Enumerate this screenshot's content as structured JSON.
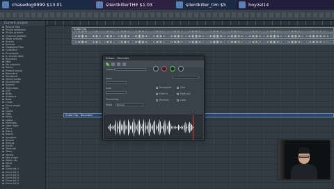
{
  "donations": [
    {
      "name": "chasedog9999",
      "amount": "$13.01"
    },
    {
      "name": "silentkillerTHE",
      "amount": "$1.03"
    },
    {
      "name": "silentkiller_tim",
      "amount": "$5"
    },
    {
      "name": "hoyzel14",
      "amount": ""
    }
  ],
  "browser": {
    "header": "Current project",
    "items": [
      "Recent files",
      "Plugin database",
      "Plugin presets",
      "Channel presets",
      "Mixer presets",
      "Scores",
      "Backup",
      "Clipboard files",
      "Collected",
      "Envelopes",
      "IL shared data",
      "Impulses",
      "Misc",
      "My projects",
      "Packs",
      "Project bones",
      "Recorded",
      "Rendered",
      "Sliced audio",
      "Soundfonts",
      "Speech",
      "Templates",
      "VST",
      "808s",
      "Ambient",
      "Bass",
      "Claps",
      "Drum loops",
      "FX",
      "Guitar",
      "Hats",
      "Kicks",
      "Loops",
      "Melodies",
      "Open hats",
      "Percs",
      "Piano",
      "Risers",
      "Samples",
      "Snares",
      "Strings",
      "Synth",
      "Textures",
      "Toms",
      "Vocals",
      "Vox chops",
      "Water sfx",
      "Wind",
      "Kits",
      "Drum kit 1",
      "Drum kit 2",
      "Drum kit 3",
      "Drum kit 4",
      "Drum kit 5",
      "Drum kit 6"
    ]
  },
  "playlist": {
    "clip_top_label": "Audio Clip",
    "clip_mid_label": "Audio Clip - Recorded"
  },
  "plugin": {
    "title": "Edison - Recorder",
    "field_source": "",
    "label_options": "Options",
    "label_input": "Input",
    "label_auto": "Auto",
    "label_process": "Processing",
    "label_mode": "Mode",
    "field_mode": "Normal",
    "checks": [
      {
        "label": "Normalize"
      },
      {
        "label": "Trim"
      },
      {
        "label": "Fade in"
      },
      {
        "label": "Fade out"
      },
      {
        "label": "Reverse"
      },
      {
        "label": "Loop"
      }
    ]
  }
}
